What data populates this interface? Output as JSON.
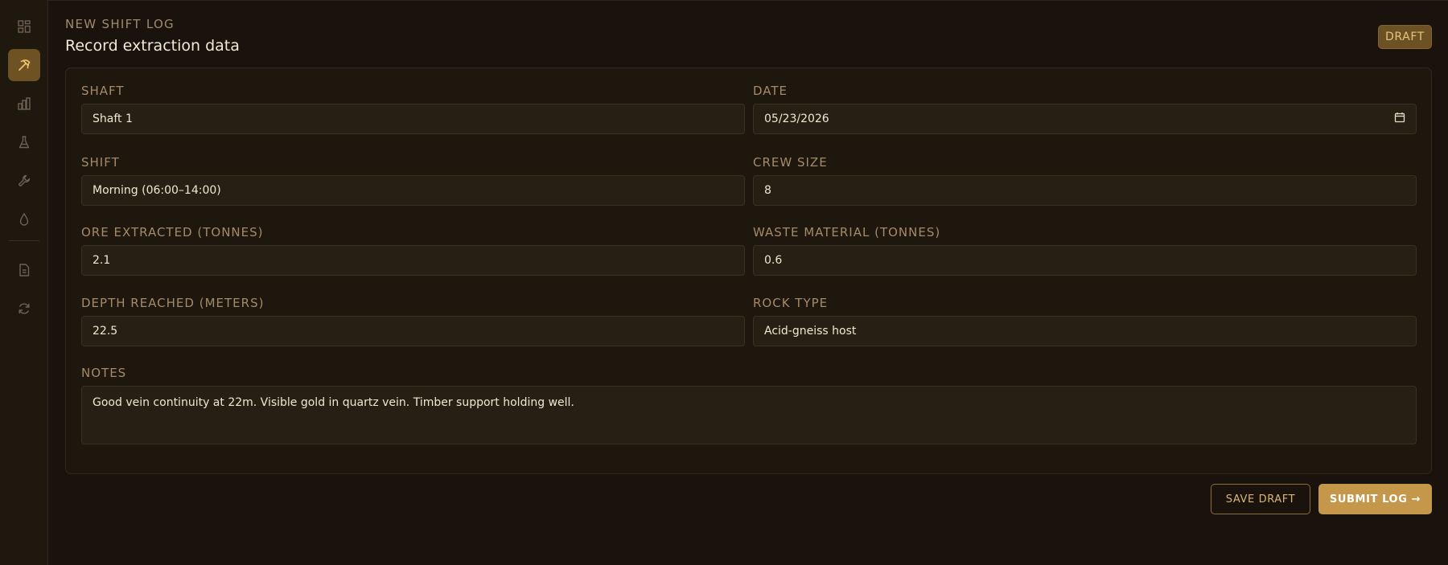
{
  "header": {
    "eyebrow": "NEW SHIFT LOG",
    "title": "Record extraction data",
    "badge": "DRAFT"
  },
  "sidebar": {
    "items": [
      {
        "icon": "dashboard-grid-icon",
        "active": false
      },
      {
        "icon": "pickaxe-icon",
        "active": true
      },
      {
        "icon": "bar-chart-icon",
        "active": false
      },
      {
        "icon": "flask-icon",
        "active": false
      },
      {
        "icon": "wrench-icon",
        "active": false
      },
      {
        "icon": "water-drop-icon",
        "active": false
      },
      {
        "icon": "document-icon",
        "active": false
      },
      {
        "icon": "refresh-icon",
        "active": false
      }
    ]
  },
  "form": {
    "shaft": {
      "label": "SHAFT",
      "value": "Shaft 1"
    },
    "date": {
      "label": "DATE",
      "value": "05/23/2026"
    },
    "shift": {
      "label": "SHIFT",
      "value": "Morning (06:00–14:00)"
    },
    "crew_size": {
      "label": "CREW SIZE",
      "value": "8"
    },
    "ore": {
      "label": "ORE EXTRACTED (TONNES)",
      "value": "2.1"
    },
    "waste": {
      "label": "WASTE MATERIAL (TONNES)",
      "value": "0.6"
    },
    "depth": {
      "label": "DEPTH REACHED (METERS)",
      "value": "22.5"
    },
    "rock": {
      "label": "ROCK TYPE",
      "value": "Acid-gneiss host"
    },
    "notes": {
      "label": "NOTES",
      "value": "Good vein continuity at 22m. Visible gold in quartz vein. Timber support holding well."
    }
  },
  "actions": {
    "save_draft": "SAVE DRAFT",
    "submit": "SUBMIT LOG →"
  },
  "colors": {
    "background": "#1a130d",
    "accent": "#c4974a",
    "active_nav": "#6e5223",
    "label": "#a48a68"
  }
}
